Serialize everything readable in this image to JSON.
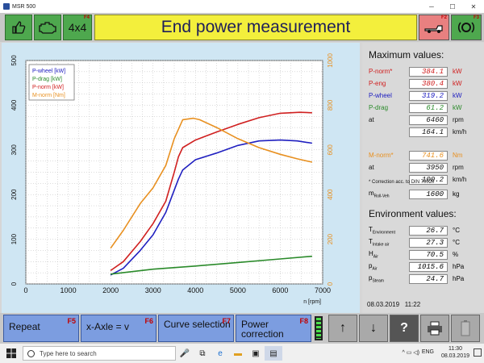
{
  "window": {
    "title": "MSR 500"
  },
  "toolbar": {
    "left_buttons": [
      {
        "icon": "thumbs-up-icon",
        "fkey": ""
      },
      {
        "icon": "engine-icon",
        "fkey": ""
      },
      {
        "label": "4x4",
        "fkey": "F4"
      }
    ],
    "title": "End power measurement",
    "right_buttons": [
      {
        "icon": "vehicle-load-icon",
        "fkey": "F2"
      },
      {
        "icon": "brake-icon",
        "fkey": "F3"
      }
    ]
  },
  "chart_data": {
    "type": "line",
    "xlabel": "n [rpm]",
    "xlim": [
      0,
      7000
    ],
    "x_ticks": [
      "0",
      "1000",
      "2000",
      "3000",
      "4000",
      "5000",
      "6000",
      "7000"
    ],
    "ylim_left": [
      0,
      500
    ],
    "y_ticks_left": [
      "0",
      "100",
      "200",
      "300",
      "400",
      "500"
    ],
    "ylim_right": [
      0,
      1000
    ],
    "y_ticks_right": [
      "0",
      "200",
      "400",
      "600",
      "800",
      "1000"
    ],
    "grid": true,
    "legend": "top-left",
    "series": [
      {
        "name": "P-wheel [kW]",
        "color": "#2020c0",
        "axis": "left",
        "x": [
          2000,
          2300,
          2700,
          3000,
          3300,
          3500,
          3600,
          3700,
          4000,
          4500,
          5000,
          5500,
          6000,
          6400,
          6750
        ],
        "y": [
          20,
          35,
          75,
          110,
          160,
          210,
          235,
          255,
          278,
          293,
          310,
          320,
          322,
          320,
          315
        ]
      },
      {
        "name": "P-drag [kW]",
        "color": "#2a8a2a",
        "axis": "left",
        "x": [
          2000,
          3000,
          4000,
          5000,
          6000,
          6750
        ],
        "y": [
          22,
          33,
          40,
          48,
          56,
          62
        ]
      },
      {
        "name": "P-norm [kW]",
        "color": "#d02020",
        "axis": "left",
        "x": [
          2000,
          2300,
          2700,
          3000,
          3300,
          3500,
          3600,
          3700,
          4000,
          4500,
          5000,
          5500,
          6000,
          6460,
          6750
        ],
        "y": [
          30,
          50,
          95,
          135,
          185,
          250,
          285,
          305,
          322,
          340,
          357,
          372,
          382,
          384.1,
          383
        ]
      },
      {
        "name": "M-norm [Nm]",
        "color": "#e89020",
        "axis": "right",
        "x": [
          2000,
          2300,
          2700,
          3000,
          3300,
          3500,
          3700,
          3950,
          4100,
          4500,
          5000,
          5500,
          6000,
          6400,
          6750
        ],
        "y": [
          160,
          240,
          360,
          430,
          530,
          650,
          735,
          741.6,
          735,
          700,
          650,
          610,
          580,
          560,
          545
        ]
      }
    ]
  },
  "max_values": {
    "title": "Maximum values:",
    "rows": [
      {
        "label": "P-norm*",
        "value": "384.1",
        "unit": "kW",
        "color": "#d02020"
      },
      {
        "label": "P-eng",
        "value": "380.4",
        "unit": "kW",
        "color": "#d02020"
      },
      {
        "label": "P-wheel",
        "value": "319.2",
        "unit": "kW",
        "color": "#2020c0"
      },
      {
        "label": "P-drag",
        "value": "61.2",
        "unit": "kW",
        "color": "#2a8a2a"
      },
      {
        "label": "at",
        "value": "6460",
        "unit": "rpm",
        "color": "#111111"
      },
      {
        "label": "",
        "value": "164.1",
        "unit": "km/h",
        "color": "#111111"
      },
      {
        "label": "M-norm*",
        "value": "741.6",
        "unit": "Nm",
        "color": "#e89020"
      },
      {
        "label": "at",
        "value": "3950",
        "unit": "rpm",
        "color": "#111111"
      },
      {
        "label": "",
        "value": "100.2",
        "unit": "km/h",
        "color": "#111111"
      }
    ],
    "note": "* Correction acc. to DIN 70020",
    "mass": {
      "label": "m",
      "sub": "Roll-Veh",
      "value": "1600",
      "unit": "kg"
    }
  },
  "environment": {
    "title": "Environment values:",
    "rows": [
      {
        "label": "T",
        "sub": "Environment",
        "value": "26.7",
        "unit": "°C"
      },
      {
        "label": "T",
        "sub": "Intake air",
        "value": "27.3",
        "unit": "°C"
      },
      {
        "label": "H",
        "sub": "Air",
        "value": "70.5",
        "unit": "%"
      },
      {
        "label": "p",
        "sub": "Air",
        "value": "1015.6",
        "unit": "hPa"
      },
      {
        "label": "p",
        "sub": "Steam",
        "value": "24.7",
        "unit": "hPa"
      }
    ]
  },
  "status": {
    "date": "08.03.2019",
    "time": "11:22"
  },
  "fkeys": [
    {
      "label": "Repeat",
      "fkey": "F5"
    },
    {
      "label": "x-Axle = v",
      "fkey": "F6"
    },
    {
      "label": "Curve selection",
      "fkey": "F7"
    },
    {
      "label": "Power correction",
      "fkey": "F8"
    }
  ],
  "nav_buttons": [
    {
      "icon": "arrow-up-icon",
      "glyph": "↑"
    },
    {
      "icon": "arrow-down-icon",
      "glyph": "↓"
    },
    {
      "icon": "help-icon",
      "glyph": "?"
    },
    {
      "icon": "printer-icon",
      "glyph": ""
    },
    {
      "icon": "battery-icon",
      "glyph": ""
    }
  ],
  "taskbar": {
    "search_placeholder": "Type here to search",
    "lang": "ENG",
    "time": "11:30",
    "date": "08.03.2019"
  }
}
